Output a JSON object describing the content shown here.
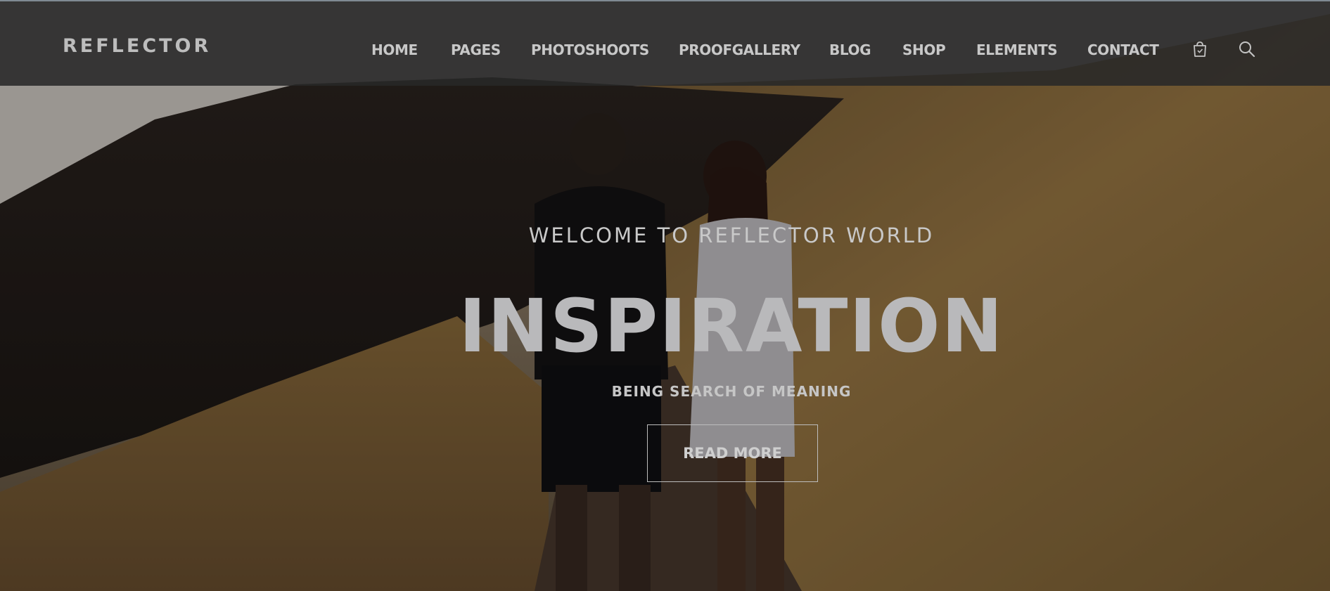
{
  "header": {
    "logo": "REFLECTOR",
    "nav": [
      {
        "label": "HOME"
      },
      {
        "label": "PAGES"
      },
      {
        "label": "PHOTOSHOOTS"
      },
      {
        "label": "PROOFGALLERY"
      },
      {
        "label": "BLOG"
      },
      {
        "label": "SHOP"
      },
      {
        "label": "ELEMENTS"
      },
      {
        "label": "CONTACT"
      }
    ],
    "icons": [
      "shopping-bag-icon",
      "search-icon"
    ]
  },
  "hero": {
    "welcome": "WELCOME TO REFLECTOR WORLD",
    "headline": "INSPIRATION",
    "subline": "BEING SEARCH OF MEANING",
    "cta_label": "READ MORE"
  },
  "colors": {
    "header_bg": "#282828",
    "nav_text": "#c8c8c8",
    "headline_text": "#b9b9bb"
  }
}
